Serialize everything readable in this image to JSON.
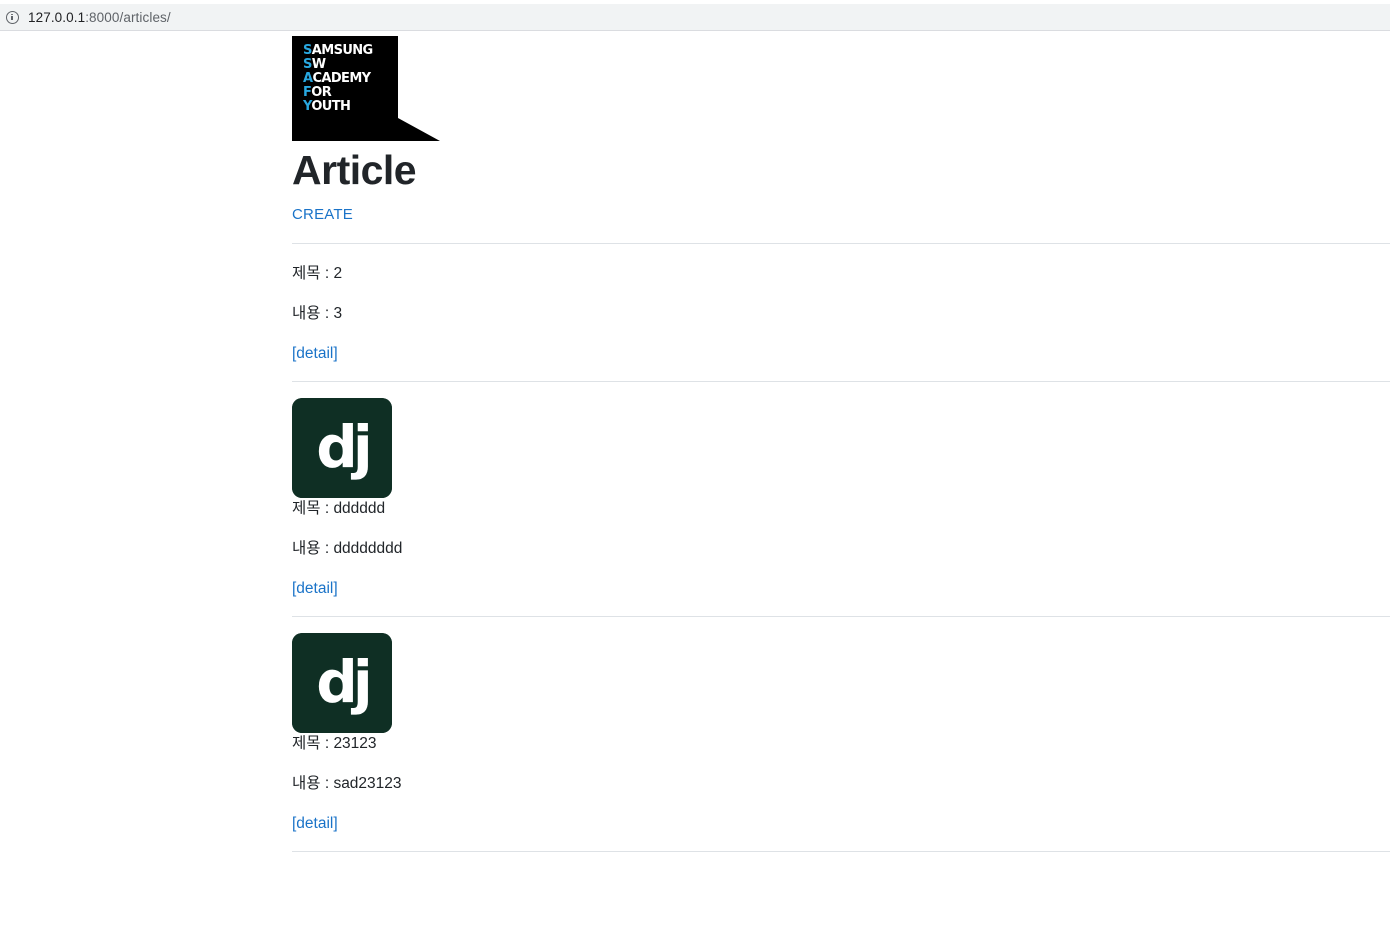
{
  "browser": {
    "url_host": "127.0.0.1",
    "url_rest": ":8000/articles/"
  },
  "logo": {
    "lines": [
      {
        "first": "S",
        "rest": "AMSUNG"
      },
      {
        "first": "S",
        "rest": "W"
      },
      {
        "first": "A",
        "rest": "CADEMY"
      },
      {
        "first": "F",
        "rest": "OR"
      },
      {
        "first": "Y",
        "rest": "OUTH"
      }
    ]
  },
  "page": {
    "title": "Article",
    "create_label": "CREATE"
  },
  "articles": [
    {
      "has_image": false,
      "title_label": "제목 : 2",
      "content_label": "내용 : 3",
      "detail_label": "[detail]"
    },
    {
      "has_image": true,
      "title_label": "제목 : dddddd",
      "content_label": "내용 : dddddddd",
      "detail_label": "[detail]"
    },
    {
      "has_image": true,
      "title_label": "제목 : 23123",
      "content_label": "내용 : sad23123",
      "detail_label": "[detail]"
    }
  ],
  "colors": {
    "link": "#1a73c8",
    "django_green": "#0f2f24",
    "logo_accent": "#29a8e0"
  }
}
